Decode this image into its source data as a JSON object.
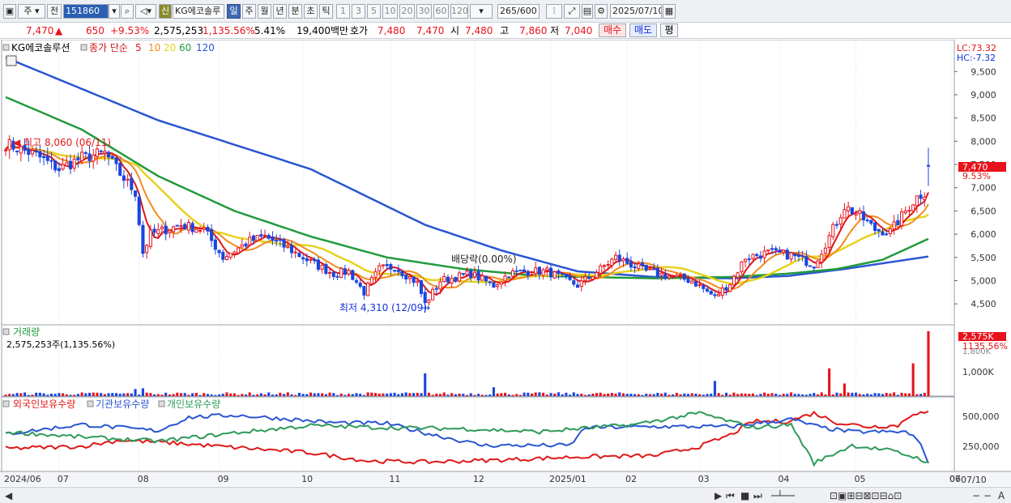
{
  "toolbar": {
    "market": "주",
    "prev": "전",
    "code": "151860",
    "badge": "신",
    "name": "KG에코솔루",
    "periods": [
      "일",
      "주",
      "월",
      "년",
      "분",
      "초",
      "틱"
    ],
    "active_period": "일",
    "intervals": [
      "1",
      "3",
      "5",
      "10",
      "20",
      "30",
      "60",
      "120"
    ],
    "count": "265",
    "count_max": "/600",
    "date": "2025/07/10"
  },
  "quote": {
    "price": "7,470",
    "change_arrow": "▲",
    "change": "650",
    "change_pct": "+9.53%",
    "volume": "2,575,253",
    "volume_pct": "1,135.56%",
    "turnover": "5.41%",
    "amount": "19,400백만",
    "bid_label": "호가",
    "bid1": "7,480",
    "bid2": "7,470",
    "open_label": "시",
    "open": "7,480",
    "high_label": "고",
    "high": "7,860",
    "low_label": "저",
    "low": "7,040",
    "buy": "매수",
    "sell": "매도",
    "eval": "평"
  },
  "price_panel": {
    "stock_label": "KG에코솔루션",
    "ma_label": "종가 단순",
    "ma_periods": [
      {
        "p": "5",
        "color": "#e01818"
      },
      {
        "p": "10",
        "color": "#f08c1e"
      },
      {
        "p": "20",
        "color": "#e6d21e"
      },
      {
        "p": "60",
        "color": "#229a3c"
      },
      {
        "p": "120",
        "color": "#2a55d2"
      }
    ],
    "lc": "LC:73.32",
    "hc": "HC:-7.32",
    "last_price": "7,470",
    "last_pct": "9.53%",
    "high_note": "최고 8,060 (06/11)",
    "low_note": "최저 4,310 (12/09)",
    "dividend_note": "배당락(0.00%)"
  },
  "volume_panel": {
    "title": "거래량",
    "value": "2,575,253주(1,135.56%)",
    "last_label": "2,575K",
    "last_pct": "1135.56%",
    "hidden_tick": "1,800K",
    "tick": "1,000K"
  },
  "holdings_panel": {
    "legend": [
      "외국인보유수량",
      "기관보유수량",
      "개인보유수량"
    ],
    "colors": [
      "#e01818",
      "#2a55d2",
      "#2e9a5a"
    ],
    "ticks": [
      "500,000",
      "250,000"
    ]
  },
  "x_axis": {
    "labels": [
      "2024/06",
      "07",
      "08",
      "09",
      "10",
      "11",
      "12",
      "2025/01",
      "02",
      "03",
      "04",
      "05",
      "06",
      "07"
    ],
    "right_label": "07/10"
  },
  "chart_data": {
    "type": "candlestick",
    "title": "KG에코솔루션",
    "y_ticks": [
      4500,
      5000,
      5500,
      6000,
      6500,
      7000,
      7500,
      8000,
      8500,
      9000,
      9500
    ],
    "ylim": [
      4050,
      10150
    ],
    "months": [
      "2024/06",
      "07",
      "08",
      "09",
      "10",
      "11",
      "12",
      "2025/01",
      "02",
      "03",
      "04",
      "05",
      "06",
      "07"
    ],
    "close_keypoints": [
      [
        0,
        7950
      ],
      [
        8,
        7700
      ],
      [
        14,
        7400
      ],
      [
        20,
        7650
      ],
      [
        26,
        7750
      ],
      [
        30,
        7300
      ],
      [
        34,
        6900
      ],
      [
        36,
        5600
      ],
      [
        38,
        6000
      ],
      [
        46,
        6200
      ],
      [
        52,
        6100
      ],
      [
        57,
        5500
      ],
      [
        64,
        5850
      ],
      [
        68,
        5950
      ],
      [
        74,
        5700
      ],
      [
        80,
        5400
      ],
      [
        86,
        5150
      ],
      [
        90,
        5200
      ],
      [
        94,
        4750
      ],
      [
        98,
        5250
      ],
      [
        102,
        5300
      ],
      [
        108,
        4950
      ],
      [
        110,
        4500
      ],
      [
        114,
        5000
      ],
      [
        122,
        5150
      ],
      [
        128,
        4900
      ],
      [
        132,
        5150
      ],
      [
        136,
        5200
      ],
      [
        142,
        5200
      ],
      [
        150,
        4900
      ],
      [
        156,
        5250
      ],
      [
        160,
        5500
      ],
      [
        168,
        5200
      ],
      [
        174,
        5100
      ],
      [
        180,
        5000
      ],
      [
        186,
        4650
      ],
      [
        190,
        4950
      ],
      [
        194,
        5500
      ],
      [
        200,
        5600
      ],
      [
        206,
        5550
      ],
      [
        212,
        5350
      ],
      [
        216,
        5950
      ],
      [
        220,
        6600
      ],
      [
        224,
        6400
      ],
      [
        228,
        6100
      ],
      [
        232,
        6050
      ],
      [
        236,
        6500
      ],
      [
        239,
        6800
      ],
      [
        241,
        6900
      ],
      [
        242,
        7470
      ]
    ],
    "ma_lines": {
      "ma60": [
        [
          0,
          8950
        ],
        [
          20,
          8250
        ],
        [
          40,
          7250
        ],
        [
          60,
          6500
        ],
        [
          80,
          5950
        ],
        [
          100,
          5500
        ],
        [
          120,
          5250
        ],
        [
          140,
          5100
        ],
        [
          170,
          5050
        ],
        [
          190,
          5080
        ],
        [
          205,
          5150
        ],
        [
          218,
          5250
        ],
        [
          230,
          5450
        ],
        [
          242,
          5900
        ]
      ],
      "ma120": [
        [
          0,
          9800
        ],
        [
          40,
          8450
        ],
        [
          80,
          7400
        ],
        [
          110,
          6200
        ],
        [
          130,
          5650
        ],
        [
          150,
          5200
        ],
        [
          170,
          5080
        ],
        [
          190,
          5050
        ],
        [
          205,
          5100
        ],
        [
          220,
          5250
        ],
        [
          242,
          5520
        ]
      ]
    },
    "last": {
      "open": 7480,
      "high": 7860,
      "low": 7040,
      "close": 7470
    },
    "period_high": {
      "value": 8060,
      "date": "06/11"
    },
    "period_low": {
      "value": 4310,
      "date": "12/09"
    },
    "volume_last": 2575253,
    "volume_ylim": [
      0,
      2700000
    ],
    "holdings": {
      "series": [
        {
          "name": "외국인보유수량",
          "keypoints": [
            [
              0,
              220000
            ],
            [
              20,
              240000
            ],
            [
              30,
              300000
            ],
            [
              45,
              270000
            ],
            [
              60,
              230000
            ],
            [
              80,
              180000
            ],
            [
              95,
              100000
            ],
            [
              110,
              90000
            ],
            [
              130,
              110000
            ],
            [
              150,
              140000
            ],
            [
              170,
              150000
            ],
            [
              182,
              240000
            ],
            [
              190,
              350000
            ],
            [
              196,
              480000
            ],
            [
              205,
              480000
            ],
            [
              212,
              560000
            ],
            [
              218,
              470000
            ],
            [
              226,
              430000
            ],
            [
              234,
              440000
            ],
            [
              238,
              560000
            ],
            [
              242,
              560000
            ]
          ]
        },
        {
          "name": "기관보유수량",
          "keypoints": [
            [
              0,
              360000
            ],
            [
              20,
              450000
            ],
            [
              40,
              390000
            ],
            [
              48,
              520000
            ],
            [
              60,
              540000
            ],
            [
              75,
              500000
            ],
            [
              85,
              470000
            ],
            [
              100,
              460000
            ],
            [
              110,
              370000
            ],
            [
              125,
              250000
            ],
            [
              140,
              250000
            ],
            [
              148,
              250000
            ],
            [
              152,
              420000
            ],
            [
              170,
              430000
            ],
            [
              190,
              430000
            ],
            [
              206,
              500000
            ],
            [
              214,
              420000
            ],
            [
              222,
              380000
            ],
            [
              236,
              380000
            ],
            [
              240,
              280000
            ],
            [
              242,
              60000
            ]
          ]
        },
        {
          "name": "개인보유수량",
          "keypoints": [
            [
              0,
              380000
            ],
            [
              20,
              330000
            ],
            [
              40,
              290000
            ],
            [
              60,
              370000
            ],
            [
              80,
              440000
            ],
            [
              100,
              420000
            ],
            [
              120,
              410000
            ],
            [
              140,
              380000
            ],
            [
              150,
              410000
            ],
            [
              165,
              450000
            ],
            [
              182,
              560000
            ],
            [
              196,
              420000
            ],
            [
              206,
              450000
            ],
            [
              212,
              80000
            ],
            [
              222,
              250000
            ],
            [
              232,
              200000
            ],
            [
              240,
              120000
            ],
            [
              242,
              80000
            ]
          ]
        }
      ],
      "ylim": [
        0,
        700000
      ]
    }
  }
}
